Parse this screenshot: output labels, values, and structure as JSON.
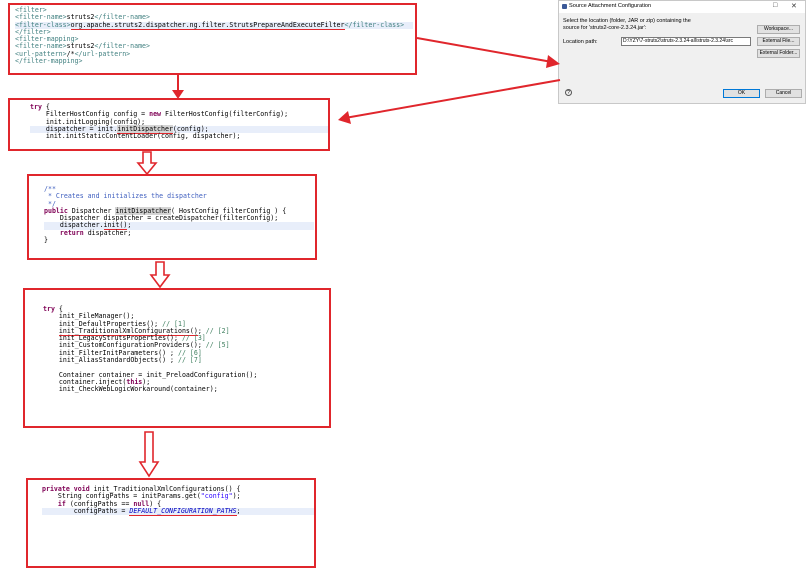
{
  "xml_snippet": {
    "lines": [
      [
        {
          "t": "<filter>",
          "c": "tag"
        }
      ],
      [
        {
          "t": "<filter-name>",
          "c": "tag"
        },
        {
          "t": "struts2",
          "c": ""
        },
        {
          "t": "</filter-name>",
          "c": "tag"
        }
      ],
      [
        {
          "t": "<filter-class>",
          "c": "tag"
        },
        {
          "t": "org.apache.struts2.dispatcher.ng.filter.StrutsPrepareAndExecuteFilter",
          "c": "rul"
        },
        {
          "t": "</filter-class>",
          "c": "tag"
        }
      ],
      [
        {
          "t": "</filter>",
          "c": "tag"
        }
      ],
      [
        {
          "t": "<filter-mapping>",
          "c": "tag"
        }
      ],
      [
        {
          "t": "<filter-name>",
          "c": "tag"
        },
        {
          "t": "struts2",
          "c": ""
        },
        {
          "t": "</filter-name>",
          "c": "tag"
        }
      ],
      [
        {
          "t": "<url-pattern>",
          "c": "tag"
        },
        {
          "t": "/*",
          "c": ""
        },
        {
          "t": "</url-pattern>",
          "c": "tag"
        }
      ],
      [
        {
          "t": "</filter-mapping>",
          "c": "tag"
        }
      ]
    ],
    "highlight_line": 2
  },
  "filter_init_snippet": {
    "lines": [
      [
        {
          "t": "try",
          "c": "kw"
        },
        {
          "t": " {",
          "c": ""
        }
      ],
      [
        {
          "t": "    FilterHostConfig config = ",
          "c": ""
        },
        {
          "t": "new",
          "c": "kw"
        },
        {
          "t": " FilterHostConfig(filterConfig);",
          "c": ""
        }
      ],
      [
        {
          "t": "    init.initLogging(config);",
          "c": ""
        }
      ],
      [
        {
          "t": "    dispatcher = init.",
          "c": ""
        },
        {
          "t": "initDispatcher",
          "c": "mark rul"
        },
        {
          "t": "(config);",
          "c": ""
        }
      ],
      [
        {
          "t": "    init.initStaticContentLoader(config, dispatcher);",
          "c": ""
        }
      ]
    ],
    "highlight_line": 3
  },
  "init_dispatcher_snippet": {
    "lines": [
      [
        {
          "t": "/**",
          "c": "jd"
        }
      ],
      [
        {
          "t": " * Creates and initializes the dispatcher",
          "c": "jd"
        }
      ],
      [
        {
          "t": " */",
          "c": "jd"
        }
      ],
      [
        {
          "t": "public",
          "c": "kw"
        },
        {
          "t": " Dispatcher ",
          "c": ""
        },
        {
          "t": "initDispatcher",
          "c": "mark"
        },
        {
          "t": "( HostConfig filterConfig ) {",
          "c": ""
        }
      ],
      [
        {
          "t": "    Dispatcher dispatcher = createDispatcher(filterConfig);",
          "c": ""
        }
      ],
      [
        {
          "t": "    dispatcher.",
          "c": ""
        },
        {
          "t": "init()",
          "c": "rul"
        },
        {
          "t": ";",
          "c": ""
        }
      ],
      [
        {
          "t": "    ",
          "c": ""
        },
        {
          "t": "return",
          "c": "kw"
        },
        {
          "t": " dispatcher;",
          "c": ""
        }
      ],
      [
        {
          "t": "}",
          "c": ""
        }
      ]
    ],
    "highlight_line": 5
  },
  "dispatcher_init_snippet": {
    "lines": [
      [
        {
          "t": "try",
          "c": "kw"
        },
        {
          "t": " {",
          "c": ""
        }
      ],
      [
        {
          "t": "    init_FileManager();",
          "c": ""
        }
      ],
      [
        {
          "t": "    init_DefaultProperties(); ",
          "c": ""
        },
        {
          "t": "// [1]",
          "c": "cm"
        }
      ],
      [
        {
          "t": "    ",
          "c": ""
        },
        {
          "t": "init_TraditionalXmlConfigurations()",
          "c": "rul"
        },
        {
          "t": "; ",
          "c": ""
        },
        {
          "t": "// [2]",
          "c": "cm"
        }
      ],
      [
        {
          "t": "    init_LegacyStrutsProperties(); ",
          "c": ""
        },
        {
          "t": "// [3]",
          "c": "cm"
        }
      ],
      [
        {
          "t": "    init_CustomConfigurationProviders(); ",
          "c": ""
        },
        {
          "t": "// [5]",
          "c": "cm"
        }
      ],
      [
        {
          "t": "    init_FilterInitParameters() ; ",
          "c": ""
        },
        {
          "t": "// [6]",
          "c": "cm"
        }
      ],
      [
        {
          "t": "    init_AliasStandardObjects() ; ",
          "c": ""
        },
        {
          "t": "// [7]",
          "c": "cm"
        }
      ],
      [
        {
          "t": "",
          "c": ""
        }
      ],
      [
        {
          "t": "    Container container = init_PreloadConfiguration();",
          "c": ""
        }
      ],
      [
        {
          "t": "    container.inject(",
          "c": ""
        },
        {
          "t": "this",
          "c": "kw"
        },
        {
          "t": ");",
          "c": ""
        }
      ],
      [
        {
          "t": "    init_CheckWebLogicWorkaround(container);",
          "c": ""
        }
      ]
    ],
    "highlight_line": -1
  },
  "xml_config_snippet": {
    "lines": [
      [
        {
          "t": "private",
          "c": "kw"
        },
        {
          "t": " ",
          "c": ""
        },
        {
          "t": "void",
          "c": "kw"
        },
        {
          "t": " init_TraditionalXmlConfigurations() {",
          "c": ""
        }
      ],
      [
        {
          "t": "    String configPaths = initParams.get(",
          "c": ""
        },
        {
          "t": "\"config\"",
          "c": "str"
        },
        {
          "t": ");",
          "c": ""
        }
      ],
      [
        {
          "t": "    ",
          "c": ""
        },
        {
          "t": "if",
          "c": "kw"
        },
        {
          "t": " (configPaths == ",
          "c": ""
        },
        {
          "t": "null",
          "c": "kw"
        },
        {
          "t": ") {",
          "c": ""
        }
      ],
      [
        {
          "t": "        configPaths = ",
          "c": ""
        },
        {
          "t": "DEFAULT_CONFIGURATION_PATHS",
          "c": "it rul"
        },
        {
          "t": ";",
          "c": ""
        }
      ]
    ],
    "highlight_line": 3
  },
  "dialog": {
    "title": "Source Attachment Configuration",
    "minimize": "□",
    "close": "✕",
    "description": "Select the location (folder, JAR or zip) containing the source for 'struts2-core-2.3.24.jar':",
    "location_label": "Location path:",
    "location_value": "D:\\YZY\\7-struts2\\struts-2.3.24-all\\struts-2.3.24\\src",
    "workspace_button": "Workspace...",
    "external_file_button": "External File...",
    "external_folder_button": "External Folder...",
    "ok_button": "OK",
    "cancel_button": "Cancel",
    "help_icon": "?"
  },
  "colors": {
    "accent": "#e0262c",
    "keyword": "#7f0055",
    "tag": "#3f7f7f",
    "comment": "#3f7f5f",
    "javadoc": "#3f5fbf",
    "highlight": "#e8eefa"
  }
}
